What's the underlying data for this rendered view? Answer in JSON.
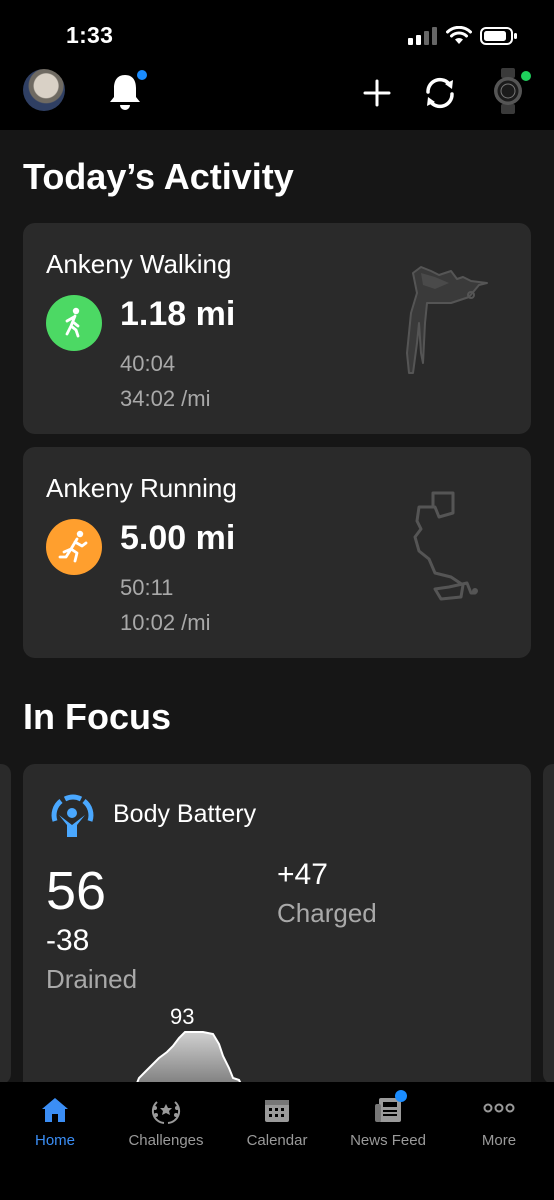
{
  "status_bar": {
    "time": "1:33"
  },
  "header": {
    "bell_badge": true,
    "watch_connected": true
  },
  "todays_activity": {
    "title": "Today’s Activity",
    "activities": [
      {
        "name": "Ankeny Walking",
        "distance": "1.18 mi",
        "duration": "40:04",
        "pace": "34:02 /mi",
        "color": "#4cd964",
        "icon": "walking-icon"
      },
      {
        "name": "Ankeny Running",
        "distance": "5.00 mi",
        "duration": "50:11",
        "pace": "10:02 /mi",
        "color": "#ff9f2e",
        "icon": "running-icon"
      }
    ]
  },
  "in_focus": {
    "title": "In Focus",
    "body_battery": {
      "title": "Body Battery",
      "value": "56",
      "drained_value": "-38",
      "drained_label": "Drained",
      "charged_value": "+47",
      "charged_label": "Charged",
      "peak": "93",
      "accent": "#4aa8ff"
    }
  },
  "tabbar": {
    "items": [
      {
        "label": "Home",
        "active": true
      },
      {
        "label": "Challenges",
        "active": false
      },
      {
        "label": "Calendar",
        "active": false
      },
      {
        "label": "News Feed",
        "active": false
      },
      {
        "label": "More",
        "active": false
      }
    ]
  }
}
